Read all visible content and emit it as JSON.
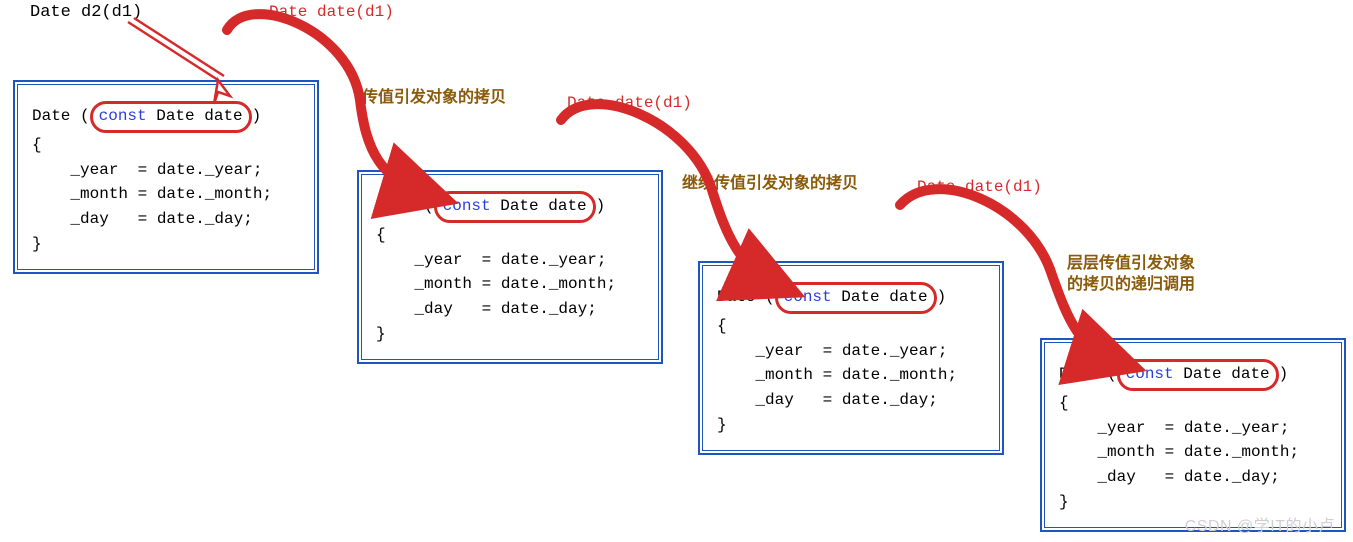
{
  "top_code": "Date d2(d1)",
  "labels": {
    "l1": "Date date(d1)",
    "l2": "Date date(d1)",
    "l3": "Date date(d1)",
    "c1": "传值引发对象的拷贝",
    "c2": "继续传值引发对象的拷贝",
    "c3": "层层传值引发对象\n的拷贝的递归调用"
  },
  "code": {
    "sig_pre": "Date (",
    "sig_kw": "const",
    "sig_rest": " Date date",
    "sig_post": ")",
    "body": "{\n    _year  = date._year;\n    _month = date._month;\n    _day   = date._day;\n}"
  },
  "watermark": "CSDN @学IT的小卢"
}
